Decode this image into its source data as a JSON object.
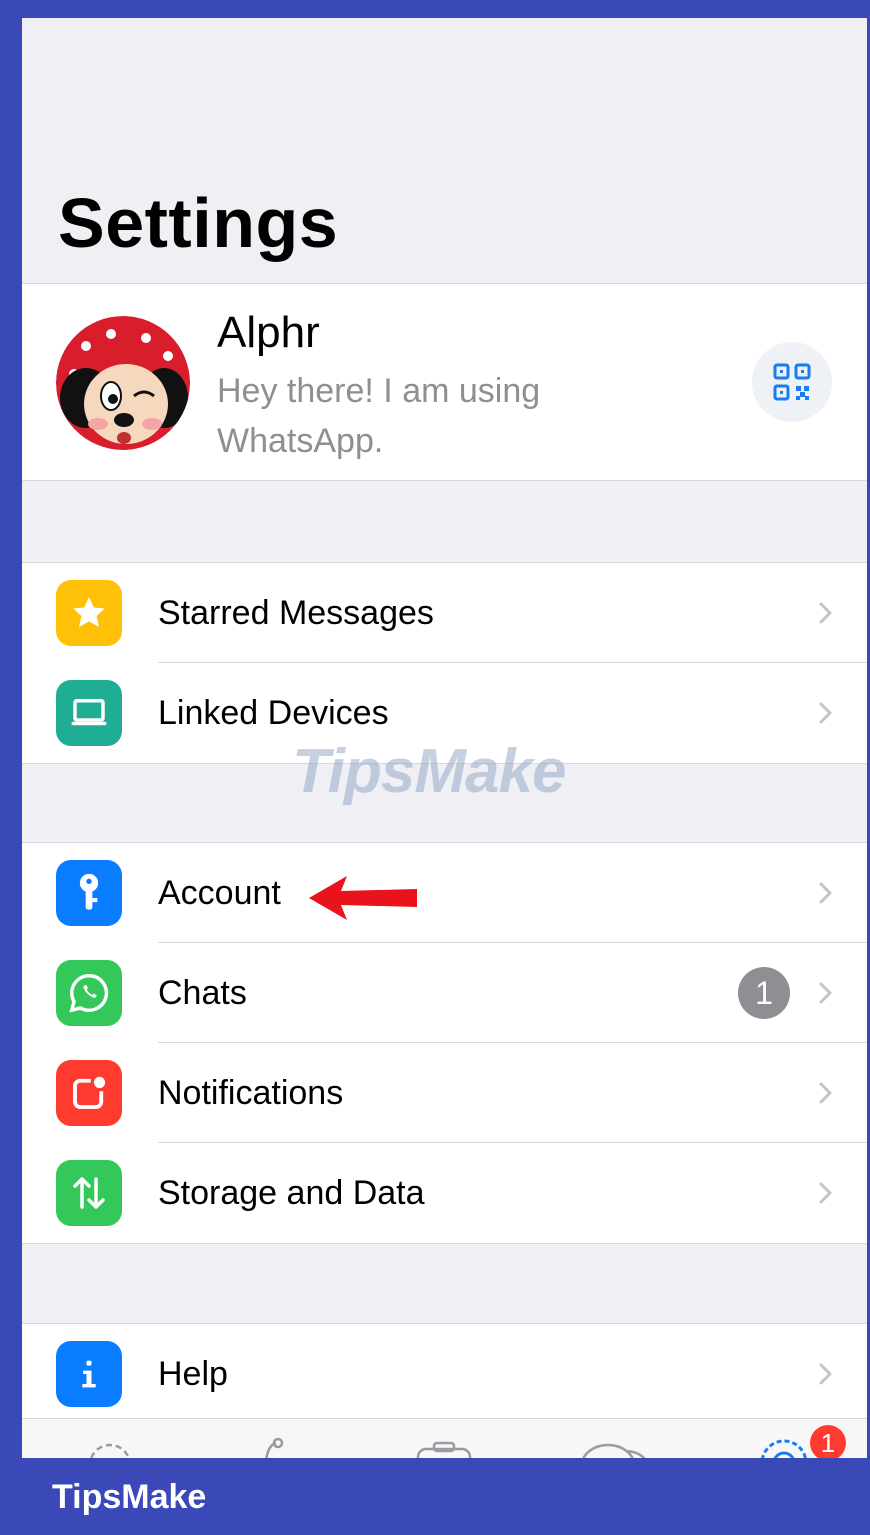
{
  "header": {
    "title": "Settings"
  },
  "profile": {
    "name": "Alphr",
    "status": "Hey there! I am using WhatsApp."
  },
  "groups": {
    "g1": [
      {
        "label": "Starred Messages",
        "color": "#ffc107",
        "icon": "star-icon"
      },
      {
        "label": "Linked Devices",
        "color": "#1fae94",
        "icon": "laptop-icon"
      }
    ],
    "g2": [
      {
        "label": "Account",
        "color": "#0a7cff",
        "icon": "key-icon"
      },
      {
        "label": "Chats",
        "color": "#34c759",
        "icon": "whatsapp-icon",
        "badge": "1"
      },
      {
        "label": "Notifications",
        "color": "#ff3b30",
        "icon": "notification-icon"
      },
      {
        "label": "Storage and Data",
        "color": "#34c759",
        "icon": "storage-arrows-icon"
      }
    ],
    "g3": [
      {
        "label": "Help",
        "color": "#0a7cff",
        "icon": "info-icon"
      }
    ]
  },
  "tabbar": {
    "settings_badge": "1"
  },
  "watermark": "TipsMake",
  "footer": {
    "brand": "TipsMake"
  },
  "colors": {
    "frame": "#3a48b8",
    "arrow": "#e8131b",
    "badge_gray": "#8e8e93",
    "badge_red": "#ff3b30"
  }
}
